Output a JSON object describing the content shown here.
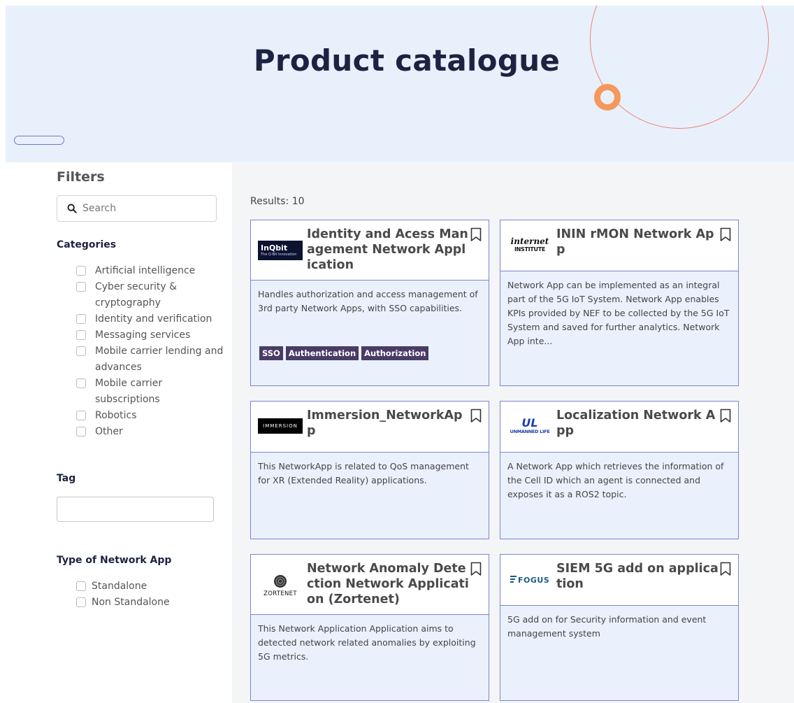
{
  "hero": {
    "title": "Product catalogue"
  },
  "sidebar": {
    "filters_title": "Filters",
    "search_placeholder": "Search",
    "categories_title": "Categories",
    "categories": [
      "Artificial intelligence",
      "Cyber security & cryptography",
      "Identity and verification",
      "Messaging services",
      "Mobile carrier lending and advances",
      "Mobile carrier subscriptions",
      "Robotics",
      "Other"
    ],
    "tag_title": "Tag",
    "tag_value": "",
    "type_title": "Type of Network App",
    "types": [
      "Standalone",
      "Non Standalone"
    ]
  },
  "main": {
    "results": "Results: 10",
    "cards": [
      {
        "title": "Identity and Acess Management Network Application",
        "logo_text": "InQbit",
        "logo_sub": "The Q-Bit Innovation",
        "description": "Handles authorization and access management of 3rd party Network Apps, with SSO capabilities.",
        "tags": [
          "SSO",
          "Authentication",
          "Authorization"
        ]
      },
      {
        "title": "ININ rMON Network App",
        "logo_text": "internet",
        "logo_sub": "INSTITUTE",
        "description": "Network App can be implemented as an integral part of the 5G IoT System. Network App enables KPIs provided by NEF to be collected by the 5G IoT System and saved for further analytics. Network App inte...",
        "tags": []
      },
      {
        "title": "Immersion_NetworkApp",
        "logo_text": "IMMERSION",
        "logo_sub": "",
        "description": "This NetworkApp is related to QoS management for XR (Extended Reality) applications.",
        "tags": []
      },
      {
        "title": "Localization Network App",
        "logo_text": "UL",
        "logo_sub": "UNMANNED LIFE",
        "description": "A Network App which retrieves the information of the Cell ID which an agent is connected and exposes it as a ROS2 topic.",
        "tags": []
      },
      {
        "title": "Network Anomaly Detection Network Application (Zortenet)",
        "logo_text": "ZORTENET",
        "logo_sub": "",
        "description": "This Network Application Application aims to detected network related anomalies by exploiting 5G metrics.",
        "tags": []
      },
      {
        "title": "SIEM 5G add on application",
        "logo_text": "FOGUS",
        "logo_sub": "",
        "description": "5G add on for Security information and event management system",
        "tags": []
      }
    ]
  }
}
